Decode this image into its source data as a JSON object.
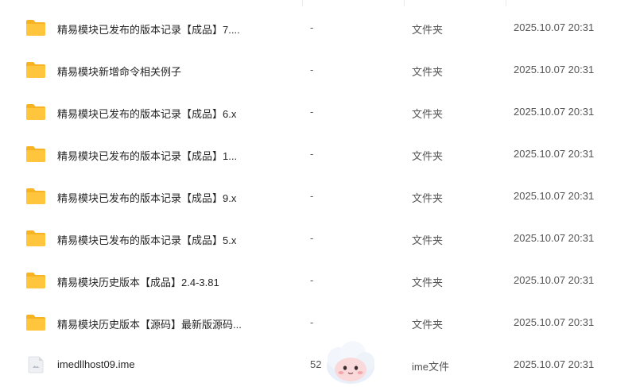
{
  "files": [
    {
      "name": "精易模块已发布的版本记录【成品】7....",
      "size": "-",
      "type": "文件夹",
      "date": "2025.10.07 20:31",
      "icon": "folder-icon"
    },
    {
      "name": "精易模块新增命令相关例子",
      "size": "-",
      "type": "文件夹",
      "date": "2025.10.07 20:31",
      "icon": "folder-icon"
    },
    {
      "name": "精易模块已发布的版本记录【成品】6.x",
      "size": "-",
      "type": "文件夹",
      "date": "2025.10.07 20:31",
      "icon": "folder-icon"
    },
    {
      "name": "精易模块已发布的版本记录【成品】1...",
      "size": "-",
      "type": "文件夹",
      "date": "2025.10.07 20:31",
      "icon": "folder-icon"
    },
    {
      "name": "精易模块已发布的版本记录【成品】9.x",
      "size": "-",
      "type": "文件夹",
      "date": "2025.10.07 20:31",
      "icon": "folder-icon"
    },
    {
      "name": "精易模块已发布的版本记录【成品】5.x",
      "size": "-",
      "type": "文件夹",
      "date": "2025.10.07 20:31",
      "icon": "folder-icon"
    },
    {
      "name": "精易模块历史版本【成品】2.4-3.81",
      "size": "-",
      "type": "文件夹",
      "date": "2025.10.07 20:31",
      "icon": "folder-icon"
    },
    {
      "name": "精易模块历史版本【源码】最新版源码...",
      "size": "-",
      "type": "文件夹",
      "date": "2025.10.07 20:31",
      "icon": "folder-icon"
    },
    {
      "name": "imedllhost09.ime",
      "size": "52",
      "type": "ime文件",
      "date": "2025.10.07 20:31",
      "icon": "file-icon"
    }
  ],
  "mascot": {
    "icon": "cloud-mascot-icon"
  },
  "colors": {
    "folder": "#FFC53D",
    "folder_back": "#F7B321",
    "text": "#262626",
    "muted": "#555555"
  }
}
